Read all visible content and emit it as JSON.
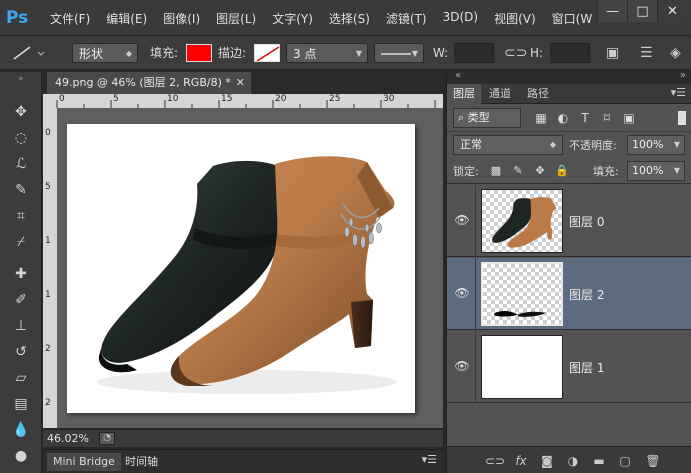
{
  "app": {
    "logo": "Ps"
  },
  "menu": [
    "文件(F)",
    "编辑(E)",
    "图像(I)",
    "图层(L)",
    "文字(Y)",
    "选择(S)",
    "滤镜(T)",
    "3D(D)",
    "视图(V)",
    "窗口(W"
  ],
  "window_controls": {
    "minimize": "—",
    "maximize": "□",
    "close": "✕"
  },
  "options": {
    "shape_mode": "形状",
    "fill_label": "填充:",
    "fill_color": "#ff0000",
    "stroke_label": "描边:",
    "stroke_width": "3 点",
    "w_label": "W:",
    "h_label": "H:"
  },
  "document": {
    "tab_title": "49.png @ 46% (图层 2, RGB/8) *",
    "zoom": "46.02%",
    "ruler_top_numbers": [
      "0",
      "5",
      "10",
      "15",
      "20",
      "25",
      "30"
    ],
    "ruler_left_numbers": [
      "0",
      "5",
      "1",
      "1",
      "2",
      "2"
    ]
  },
  "bottom_tabs": [
    "Mini Bridge",
    "时间轴"
  ],
  "panel": {
    "tabs": [
      "图层",
      "通道",
      "路径"
    ],
    "filter_type": "类型",
    "blend_mode": "正常",
    "opacity_label": "不透明度:",
    "opacity_value": "100%",
    "lock_label": "锁定:",
    "fill_label": "填充:",
    "fill_value": "100%",
    "layers": [
      {
        "name": "图层 0",
        "selected": false
      },
      {
        "name": "图层 2",
        "selected": true
      },
      {
        "name": "图层 1",
        "selected": false
      }
    ]
  },
  "colors": {
    "accent_selected": "#5c6b80",
    "ps_blue": "#39a8ee"
  }
}
